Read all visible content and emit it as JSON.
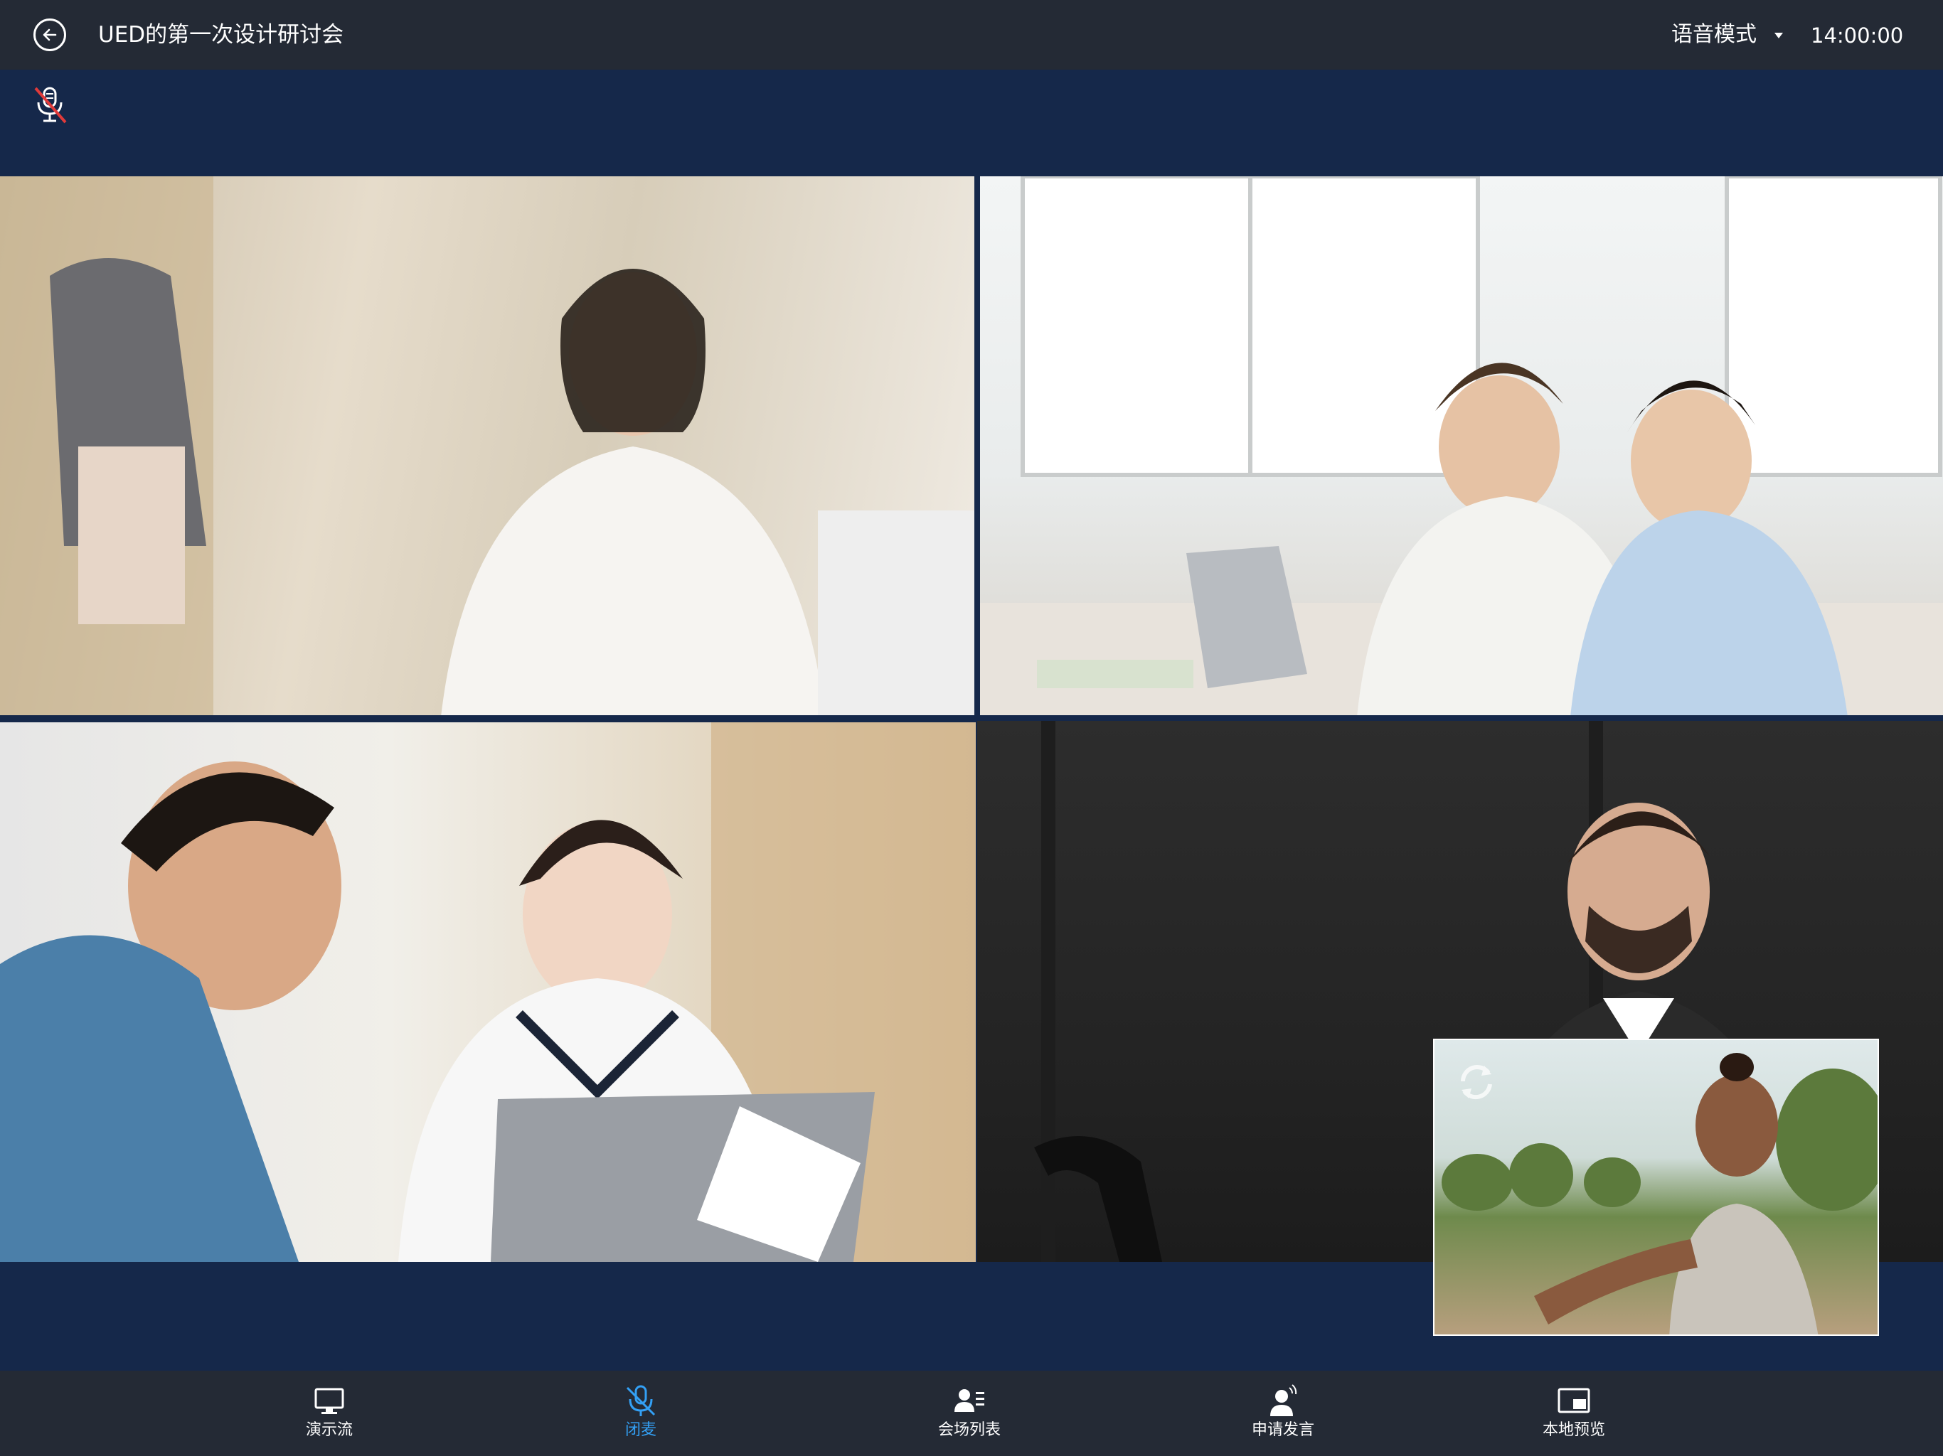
{
  "header": {
    "title": "UED的第一次设计研讨会",
    "mode_label": "语音模式",
    "time": "14:00:00"
  },
  "status": {
    "mic_state_icon": "mic-muted-icon"
  },
  "videos": [
    {
      "id": "tile-1",
      "description_icon": "video-feed"
    },
    {
      "id": "tile-2",
      "description_icon": "video-feed"
    },
    {
      "id": "tile-3",
      "description_icon": "video-feed"
    },
    {
      "id": "tile-4",
      "description_icon": "video-feed"
    }
  ],
  "toolbar": {
    "items": [
      {
        "label": "演示流",
        "icon": "monitor-icon",
        "active": false
      },
      {
        "label": "闭麦",
        "icon": "mic-off-icon",
        "active": true
      },
      {
        "label": "会场列表",
        "icon": "user-list-icon",
        "active": false
      },
      {
        "label": "申请发言",
        "icon": "raise-speak-icon",
        "active": false
      },
      {
        "label": "本地预览",
        "icon": "picture-in-picture-icon",
        "active": false
      }
    ]
  },
  "colors": {
    "topbar": "#242a35",
    "background": "#15284a",
    "accent": "#33a0f5",
    "muted_slash": "#e03a3a"
  }
}
